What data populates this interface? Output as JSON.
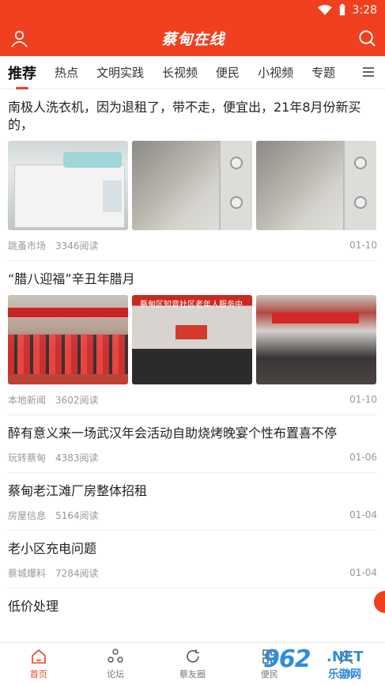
{
  "status": {
    "time": "3:28"
  },
  "header": {
    "title": "蔡甸在线",
    "user_icon": "user-icon",
    "search_icon": "search-icon"
  },
  "tabs": [
    "推荐",
    "热点",
    "文明实践",
    "长视频",
    "便民",
    "小视频",
    "专题"
  ],
  "feed": [
    {
      "title": "南极人洗衣机，因为退租了，带不走，便宜出，21年8月份新买的，",
      "source": "跳蚤市场",
      "reads": "3346阅读",
      "date": "01-10"
    },
    {
      "title": "“腊八迎福”辛丑年腊月",
      "source": "本地新闻",
      "reads": "3602阅读",
      "date": "01-10"
    },
    {
      "title": "醉有意义来一场武汉年会活动自助烧烤晚宴个性布置喜不停",
      "source": "玩转蔡甸",
      "reads": "4383阅读",
      "date": "01-06"
    },
    {
      "title": "蔡甸老江滩厂房整体招租",
      "source": "房屋信息",
      "reads": "5164阅读",
      "date": "01-04"
    },
    {
      "title": "老小区充电问题",
      "source": "蔡城爆料",
      "reads": "7284阅读",
      "date": "01-04"
    },
    {
      "title": "低价处理"
    }
  ],
  "image_text": {
    "community_banner": "蔡甸区知音社区老年人服务中"
  },
  "bottom_nav": [
    {
      "label": "首页",
      "icon": "home-icon"
    },
    {
      "label": "论坛",
      "icon": "forum-icon"
    },
    {
      "label": "蔡友圈",
      "icon": "circle-icon"
    },
    {
      "label": "便民",
      "icon": "grid-icon"
    },
    {
      "label": "我的",
      "icon": "profile-icon"
    }
  ],
  "watermark": {
    "number": "962",
    "net": ".NET",
    "cn": "乐游网"
  },
  "colors": {
    "brand": "#f1401f",
    "text": "#222222",
    "muted": "#999999"
  }
}
